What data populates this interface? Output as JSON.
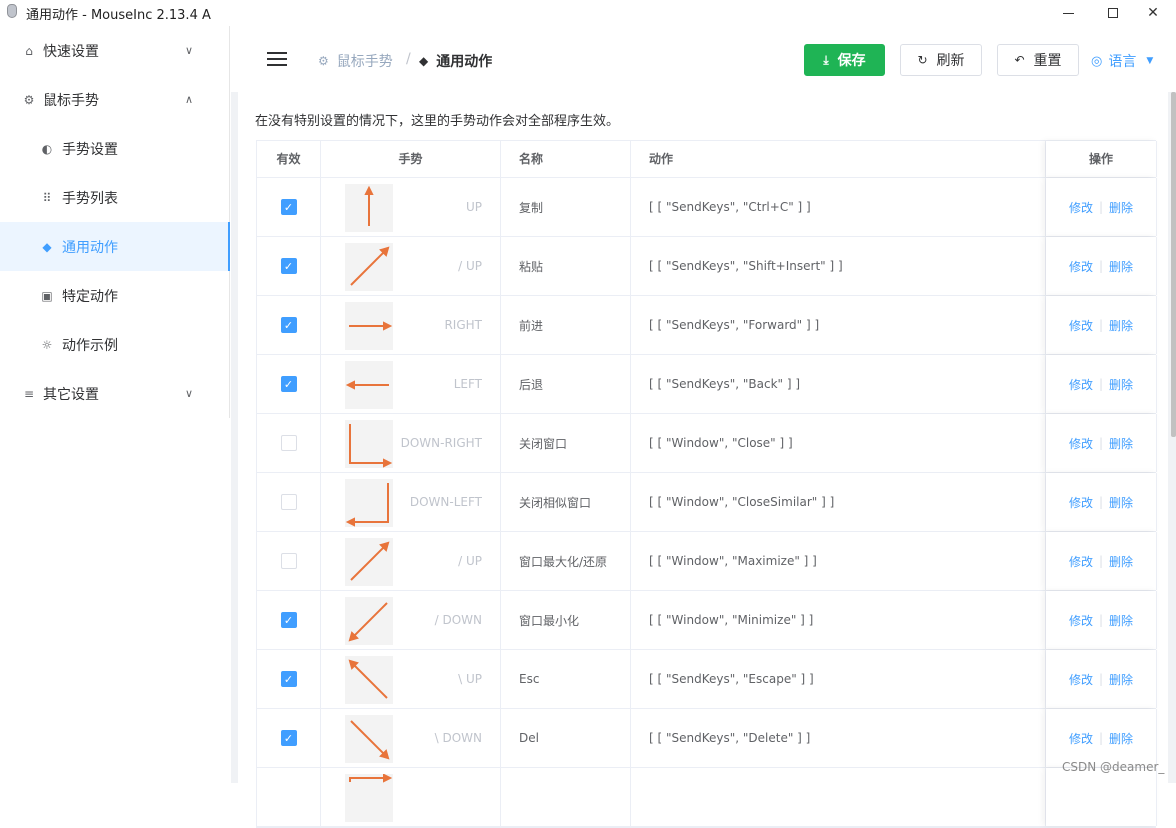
{
  "window": {
    "title": "通用动作 - MouseInc 2.13.4 A"
  },
  "sidebar": {
    "items": [
      {
        "label": "快速设置",
        "icon": "home-icon",
        "glyph": "⌂",
        "expanded": false
      },
      {
        "label": "鼠标手势",
        "icon": "gear-icon",
        "glyph": "⚙",
        "expanded": true
      },
      {
        "label": "手势设置",
        "icon": "palette-icon",
        "glyph": "◐"
      },
      {
        "label": "手势列表",
        "icon": "grid-icon",
        "glyph": "⠿"
      },
      {
        "label": "通用动作",
        "icon": "cube-icon",
        "glyph": "◆"
      },
      {
        "label": "特定动作",
        "icon": "video-icon",
        "glyph": "▣"
      },
      {
        "label": "动作示例",
        "icon": "sun-icon",
        "glyph": "☼"
      },
      {
        "label": "其它设置",
        "icon": "sliders-icon",
        "glyph": "≡",
        "expanded": false
      }
    ]
  },
  "header": {
    "breadcrumb": [
      {
        "label": "鼠标手势",
        "icon": "gear-icon"
      },
      {
        "label": "通用动作",
        "icon": "cube-icon"
      }
    ],
    "separator": "/",
    "save_label": "保存",
    "refresh_label": "刷新",
    "reset_label": "重置",
    "lang_label": "语言"
  },
  "main": {
    "description": "在没有特别设置的情况下，这里的手势动作会对全部程序生效。",
    "columns": [
      "有效",
      "手势",
      "名称",
      "动作",
      "操作"
    ],
    "edit_label": "修改",
    "delete_label": "删除",
    "rows": [
      {
        "enabled": true,
        "gesture": "UP",
        "shape": "up",
        "name": "复制",
        "action": "[ [ \"SendKeys\", \"Ctrl+C\" ] ]"
      },
      {
        "enabled": true,
        "gesture": "/ UP",
        "shape": "diag-up-right",
        "name": "粘贴",
        "action": "[ [ \"SendKeys\", \"Shift+Insert\" ] ]"
      },
      {
        "enabled": true,
        "gesture": "RIGHT",
        "shape": "right",
        "name": "前进",
        "action": "[ [ \"SendKeys\", \"Forward\" ] ]"
      },
      {
        "enabled": true,
        "gesture": "LEFT",
        "shape": "left",
        "name": "后退",
        "action": "[ [ \"SendKeys\", \"Back\" ] ]"
      },
      {
        "enabled": false,
        "gesture": "DOWN-RIGHT",
        "shape": "down-right",
        "name": "关闭窗口",
        "action": "[ [ \"Window\", \"Close\" ] ]"
      },
      {
        "enabled": false,
        "gesture": "DOWN-LEFT",
        "shape": "down-left",
        "name": "关闭相似窗口",
        "action": "[ [ \"Window\", \"CloseSimilar\" ] ]"
      },
      {
        "enabled": false,
        "gesture": "/ UP",
        "shape": "diag-up-right",
        "name": "窗口最大化/还原",
        "action": "[ [ \"Window\", \"Maximize\" ] ]"
      },
      {
        "enabled": true,
        "gesture": "/ DOWN",
        "shape": "diag-down-left",
        "name": "窗口最小化",
        "action": "[ [ \"Window\", \"Minimize\" ] ]"
      },
      {
        "enabled": true,
        "gesture": "\\ UP",
        "shape": "diag-up-left",
        "name": "Esc",
        "action": "[ [ \"SendKeys\", \"Escape\" ] ]"
      },
      {
        "enabled": true,
        "gesture": "\\ DOWN",
        "shape": "diag-down-right",
        "name": "Del",
        "action": "[ [ \"SendKeys\", \"Delete\" ] ]"
      },
      {
        "enabled": true,
        "gesture": "",
        "shape": "partial",
        "name": "",
        "action": ""
      }
    ]
  },
  "colors": {
    "accent": "#409eff",
    "save": "#1fb455",
    "gesture_stroke": "#e8743b"
  },
  "watermark": "CSDN @deamer_"
}
